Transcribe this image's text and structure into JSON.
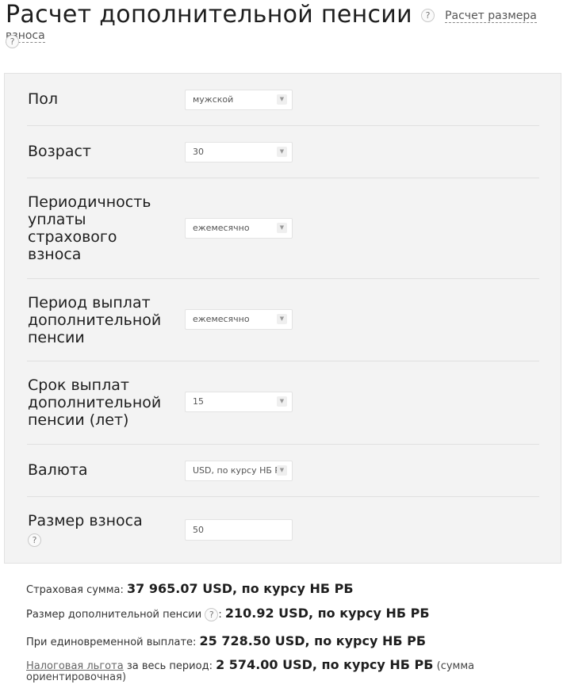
{
  "header": {
    "title": "Расчет дополнительной пенсии",
    "help_glyph": "?",
    "calc_link": "Расчет размера взноса"
  },
  "form": {
    "gender": {
      "label": "Пол",
      "value": "мужской"
    },
    "age": {
      "label": "Возраст",
      "value": "30"
    },
    "periodicity": {
      "label": "Периодичность уплаты страхового взноса",
      "value": "ежемесячно"
    },
    "payout_period": {
      "label": "Период выплат дополнительной пенсии",
      "value": "ежемесячно"
    },
    "payout_term": {
      "label": "Срок выплат дополнительной пенсии (лет)",
      "value": "15"
    },
    "currency": {
      "label": "Валюта",
      "value": "USD, по курсу НБ РБ"
    },
    "contribution": {
      "label": "Размер взноса",
      "value": "50"
    }
  },
  "results": {
    "insured_sum": {
      "label": "Страховая сумма:",
      "value": "37 965.07 USD, по курсу НБ РБ"
    },
    "additional_pension": {
      "label": "Размер дополнительной пенсии",
      "colon": ":",
      "value": "210.92 USD, по курсу НБ РБ"
    },
    "lump_sum": {
      "label": "При единовременной выплате:",
      "value": "25 728.50 USD, по курсу НБ РБ"
    },
    "tax_benefit": {
      "link": "Налоговая льгота",
      "label": "за весь период:",
      "value": "2 574.00 USD, по курсу НБ РБ",
      "note": "(сумма ориентировочная)"
    }
  }
}
